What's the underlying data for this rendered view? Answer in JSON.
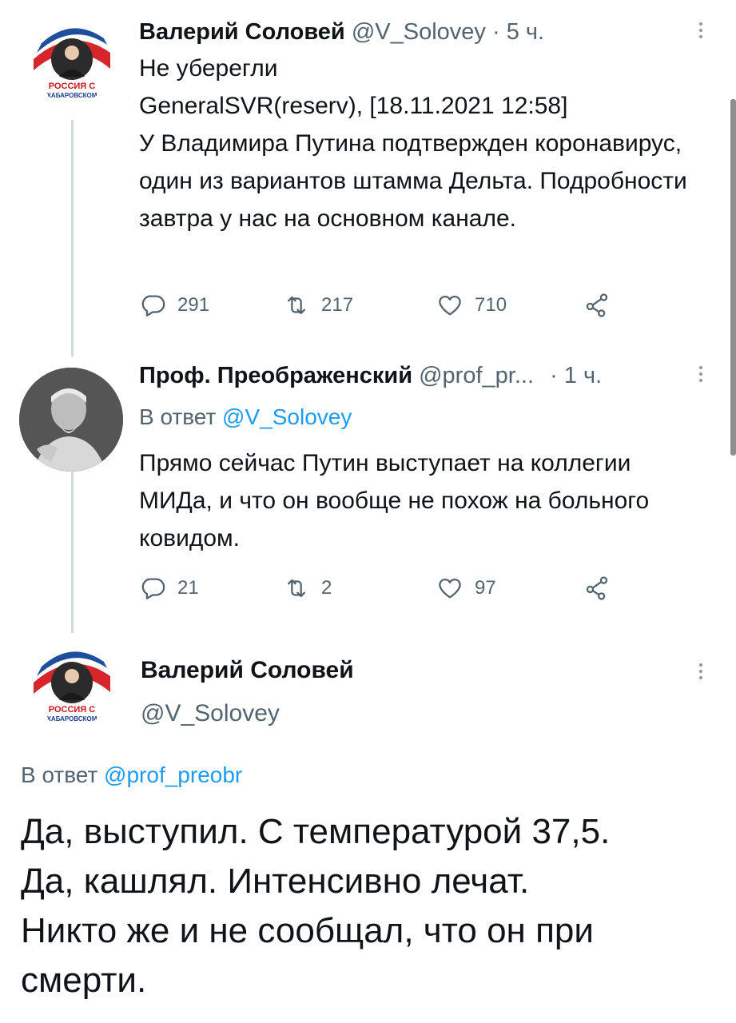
{
  "tweets": [
    {
      "author": "Валерий Соловей",
      "handle": "@V_Solovey",
      "time": "· 5 ч.",
      "avatar_caption_line1": "РОССИЯ С",
      "avatar_caption_line2": "ХАБАРОВСКОМ",
      "text": "Не уберегли\nGeneralSVR(reserv), [18.11.2021 12:58]\nУ Владимира Путина подтвержден коронавирус, один из вариантов штамма Дельта. Подробности завтра у нас на основном канале.",
      "replies": "291",
      "retweets": "217",
      "likes": "710"
    },
    {
      "author": "Проф. Преображенский",
      "handle": "@prof_pr...",
      "time": "· 1 ч.",
      "reply_prefix": "В ответ",
      "reply_to": "@V_Solovey",
      "text": "Прямо сейчас Путин выступает на коллегии МИДа, и что он вообще не похож на больного ковидом.",
      "replies": "21",
      "retweets": "2",
      "likes": "97"
    }
  ],
  "focused": {
    "author": "Валерий Соловей",
    "handle": "@V_Solovey",
    "avatar_caption_line1": "РОССИЯ С",
    "avatar_caption_line2": "ХАБАРОВСКОМ",
    "reply_prefix": "В ответ",
    "reply_to": "@prof_preobr",
    "text": "Да, выступил. С температурой 37,5.\nДа, кашлял. Интенсивно лечат.\nНикто же и не сообщал, что он при смерти."
  },
  "colors": {
    "accent": "#1d9bf0",
    "secondary_text": "#536471",
    "primary_text": "#0f1419",
    "thread_line": "#cfd9de"
  },
  "icons": [
    "reply-icon",
    "retweet-icon",
    "like-icon",
    "share-icon",
    "more-icon"
  ]
}
